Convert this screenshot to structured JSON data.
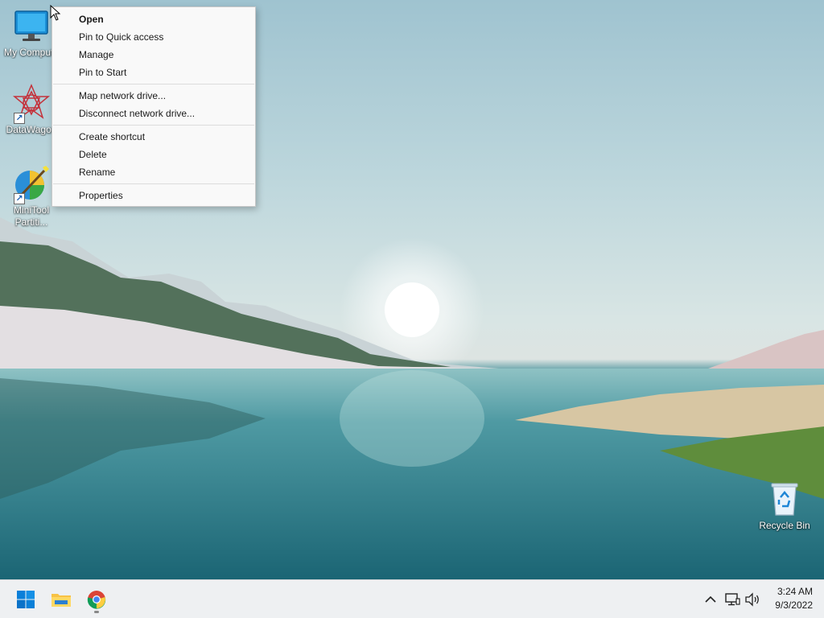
{
  "desktop_icons": [
    {
      "label": "My Compute",
      "icon": "computer-icon",
      "shortcut": false
    },
    {
      "label": "DataWagon",
      "icon": "datawagon-icon",
      "shortcut": true
    },
    {
      "label": "MiniTool Partiti...",
      "label_line1": "MiniTool",
      "label_line2": "Partiti...",
      "icon": "minitool-partition-icon",
      "shortcut": true
    },
    {
      "label": "Recycle Bin",
      "icon": "recycle-bin-icon",
      "shortcut": false
    }
  ],
  "context_menu": {
    "groups": [
      [
        "Open",
        "Pin to Quick access",
        "Manage",
        "Pin to Start"
      ],
      [
        "Map network drive...",
        "Disconnect network drive..."
      ],
      [
        "Create shortcut",
        "Delete",
        "Rename"
      ],
      [
        "Properties"
      ]
    ],
    "default_item": "Open"
  },
  "taskbar": {
    "pinned": [
      "start-button",
      "file-explorer-icon",
      "chrome-icon"
    ],
    "tray": [
      "chevron-up-icon",
      "network-icon",
      "volume-icon"
    ],
    "time": "3:24 AM",
    "date": "9/3/2022"
  }
}
